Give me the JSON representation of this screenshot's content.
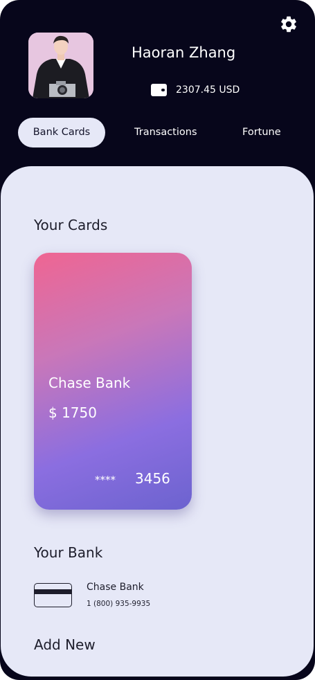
{
  "header": {
    "user_name": "Haoran Zhang",
    "balance": "2307.45 USD",
    "icons": {
      "settings": "gear-icon",
      "wallet": "wallet-icon"
    }
  },
  "tabs": [
    {
      "label": "Bank Cards",
      "active": true
    },
    {
      "label": "Transactions",
      "active": false
    },
    {
      "label": "Fortune",
      "active": false
    }
  ],
  "cards_section": {
    "title": "Your Cards",
    "card": {
      "bank": "Chase Bank",
      "amount": "$ 1750",
      "masked": "****",
      "last4": "3456",
      "gradient": [
        "#ef6592",
        "#8b6ee0",
        "#6c63cf"
      ]
    }
  },
  "bank_section": {
    "title": "Your Bank",
    "bank_name": "Chase Bank",
    "phone": "1 (800) 935-9935",
    "icon": "credit-card-icon"
  },
  "add_new": {
    "label": "Add New"
  },
  "colors": {
    "background": "#07061b",
    "panel": "#e6e8f7",
    "text_dark": "#1d1d2b"
  }
}
